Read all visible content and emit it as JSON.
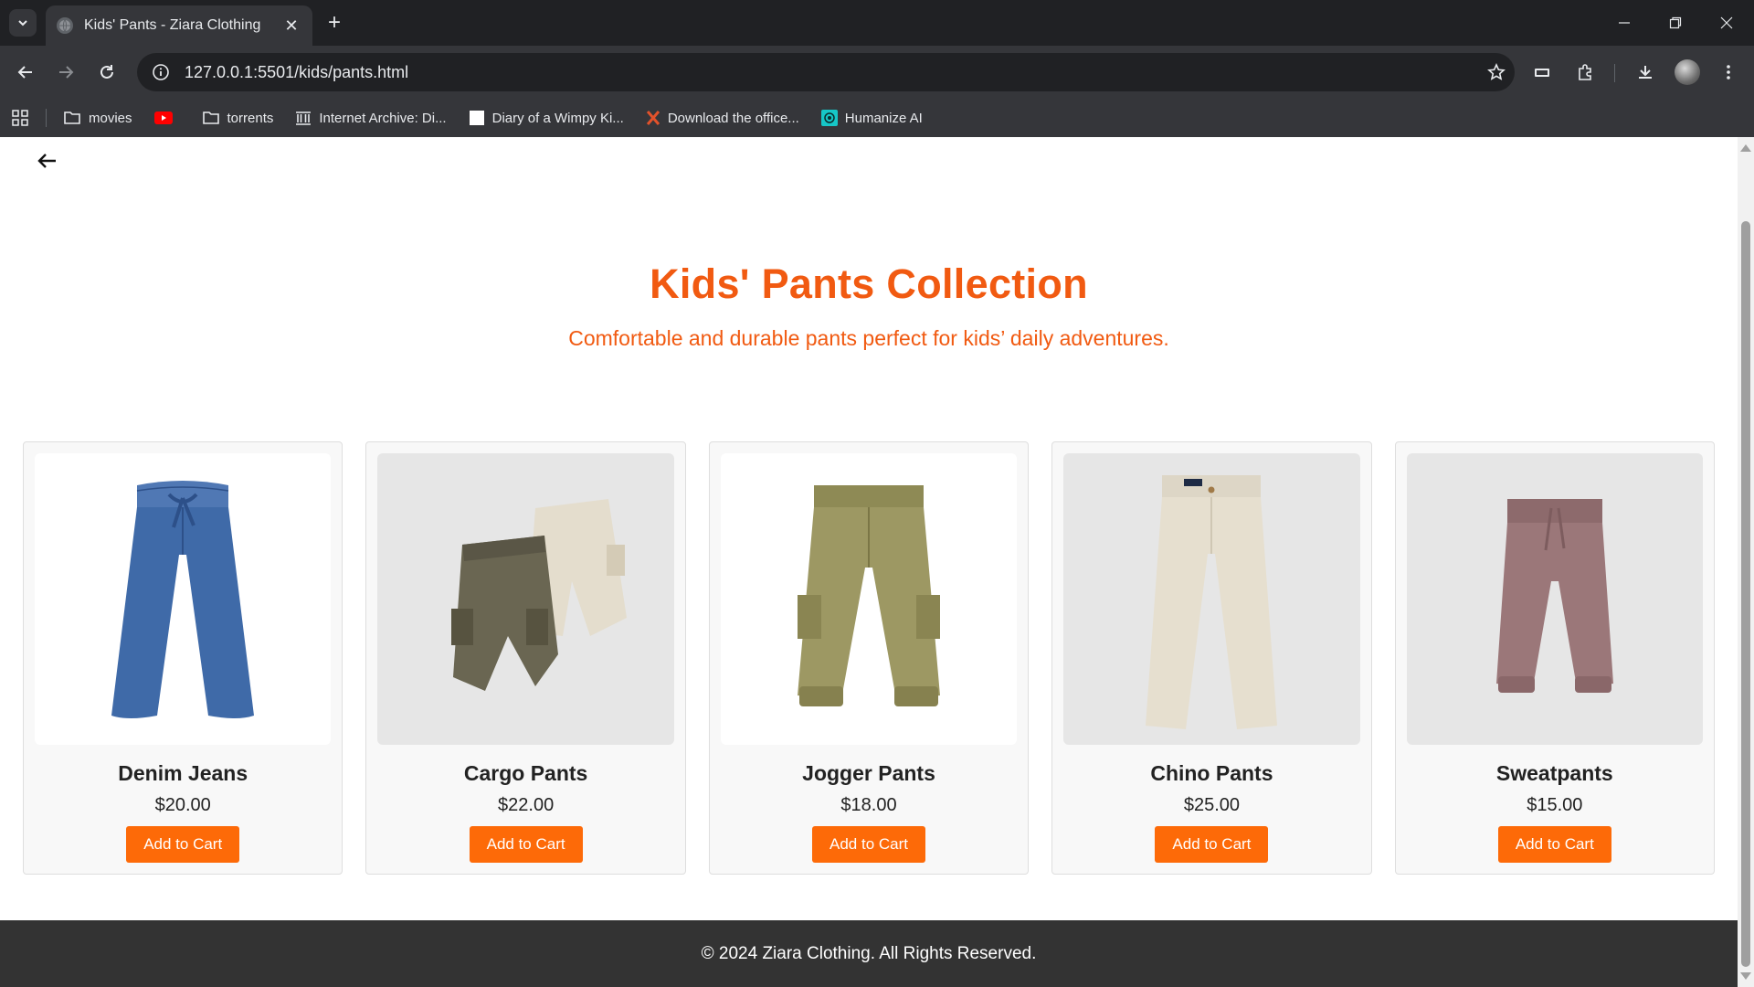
{
  "browser": {
    "tab_title": "Kids' Pants - Ziara Clothing",
    "url": "127.0.0.1:5501/kids/pants.html",
    "bookmarks": [
      {
        "label": "movies",
        "icon": "folder-icon"
      },
      {
        "label": "",
        "icon": "youtube-icon"
      },
      {
        "label": "torrents",
        "icon": "folder-icon"
      },
      {
        "label": "Internet Archive: Di...",
        "icon": "archive-icon"
      },
      {
        "label": "Diary of a Wimpy Ki...",
        "icon": "page-icon"
      },
      {
        "label": "Download the office...",
        "icon": "x-logo-icon"
      },
      {
        "label": "Humanize AI",
        "icon": "humanize-icon"
      }
    ]
  },
  "page": {
    "title": "Kids' Pants Collection",
    "subtitle": "Comfortable and durable pants perfect for kids’ daily adventures.",
    "footer": "© 2024 Ziara Clothing. All Rights Reserved.",
    "accent_color": "#f15a11",
    "button_color": "#fd6a08"
  },
  "products": [
    {
      "name": "Denim Jeans",
      "price": "$20.00",
      "button": "Add to Cart",
      "image": "denim-jeans-image"
    },
    {
      "name": "Cargo Pants",
      "price": "$22.00",
      "button": "Add to Cart",
      "image": "cargo-pants-image"
    },
    {
      "name": "Jogger Pants",
      "price": "$18.00",
      "button": "Add to Cart",
      "image": "jogger-pants-image"
    },
    {
      "name": "Chino Pants",
      "price": "$25.00",
      "button": "Add to Cart",
      "image": "chino-pants-image"
    },
    {
      "name": "Sweatpants",
      "price": "$15.00",
      "button": "Add to Cart",
      "image": "sweatpants-image"
    }
  ]
}
